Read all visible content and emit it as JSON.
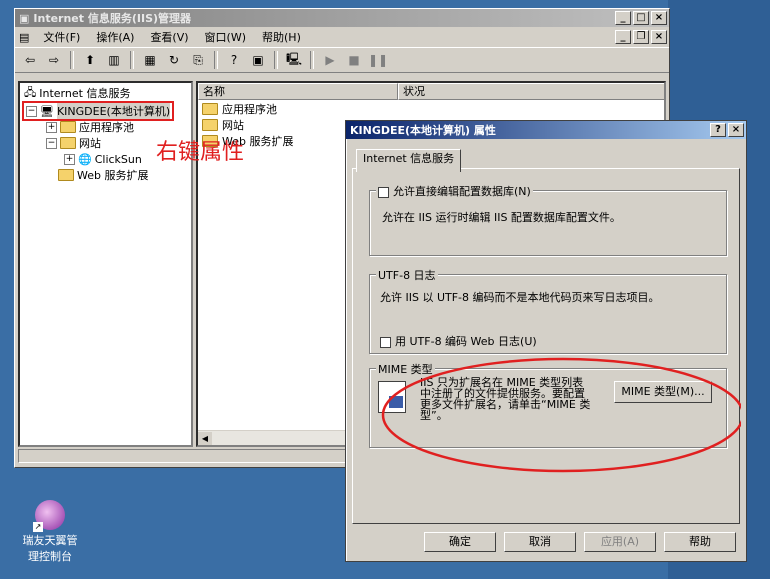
{
  "mmc": {
    "title": "Internet 信息服务(IIS)管理器",
    "menu": [
      "文件(F)",
      "操作(A)",
      "查看(V)",
      "窗口(W)",
      "帮助(H)"
    ],
    "tree": {
      "root": "Internet 信息服务",
      "computer": "KINGDEE(本地计算机)",
      "app_pools": "应用程序池",
      "websites": "网站",
      "site": "ClickSun",
      "web_ext": "Web 服务扩展"
    },
    "list": {
      "col_name": "名称",
      "col_status": "状况",
      "rows": [
        "应用程序池",
        "网站",
        "Web 服务扩展"
      ]
    }
  },
  "annotation": {
    "text": "右键属性",
    "color": "#e02020"
  },
  "dialog": {
    "title": "KINGDEE(本地计算机) 属性",
    "tab": "Internet 信息服务",
    "metabase": {
      "label": "允许直接编辑配置数据库(N)",
      "desc": "允许在 IIS 运行时编辑 IIS 配置数据库配置文件。"
    },
    "utf8": {
      "legend": "UTF-8 日志",
      "desc": "允许 IIS 以 UTF-8 编码而不是本地代码页来写日志项目。",
      "checkbox": "用 UTF-8 编码 Web 日志(U)"
    },
    "mime": {
      "legend": "MIME 类型",
      "line1": "IIS 只为扩展名在 MIME 类型列表",
      "line2": "中注册了的文件提供服务。要配置",
      "line3": "更多文件扩展名，请单击“MIME 类",
      "line4": "型”。",
      "button": "MIME 类型(M)..."
    },
    "buttons": {
      "ok": "确定",
      "cancel": "取消",
      "apply": "应用(A)",
      "help": "帮助"
    }
  },
  "desktop": {
    "icon_line1": "瑞友天翼管",
    "icon_line2": "理控制台"
  }
}
